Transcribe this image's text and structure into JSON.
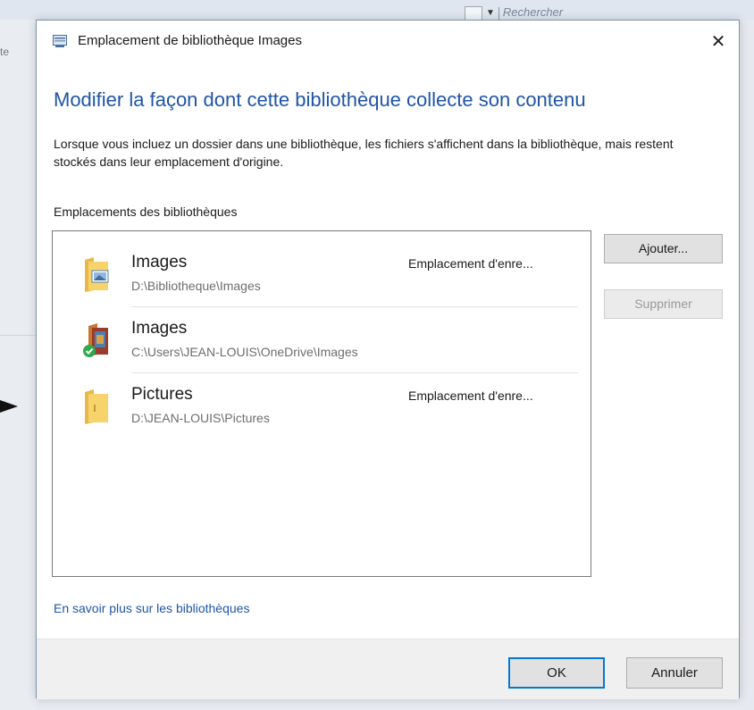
{
  "background": {
    "search_placeholder": "Rechercher",
    "left_partial_text": "te"
  },
  "dialog": {
    "title": "Emplacement de bibliothèque Images",
    "close_glyph": "✕",
    "heading": "Modifier la façon dont cette bibliothèque collecte son contenu",
    "description": "Lorsque vous incluez un dossier dans une bibliothèque, les fichiers s'affichent dans la bibliothèque, mais restent stockés dans leur emplacement d'origine.",
    "locations_label": "Emplacements des bibliothèques",
    "locations": [
      {
        "name": "Images",
        "path": "D:\\Bibliotheque\\Images",
        "status": "Emplacement d'enre...",
        "icon": "pictures-folder-icon"
      },
      {
        "name": "Images",
        "path": "C:\\Users\\JEAN-LOUIS\\OneDrive\\Images",
        "status": "",
        "icon": "onedrive-synced-folder-icon"
      },
      {
        "name": "Pictures",
        "path": "D:\\JEAN-LOUIS\\Pictures",
        "status": "Emplacement d'enre...",
        "icon": "folder-icon"
      }
    ],
    "add_button": "Ajouter...",
    "remove_button": "Supprimer",
    "learn_more_link": "En savoir plus sur les bibliothèques",
    "ok_button": "OK",
    "cancel_button": "Annuler"
  },
  "colors": {
    "heading_blue": "#1f55a6",
    "link_blue": "#1f55a6",
    "primary_border": "#0078d7",
    "synced_green": "#2fa84f"
  }
}
